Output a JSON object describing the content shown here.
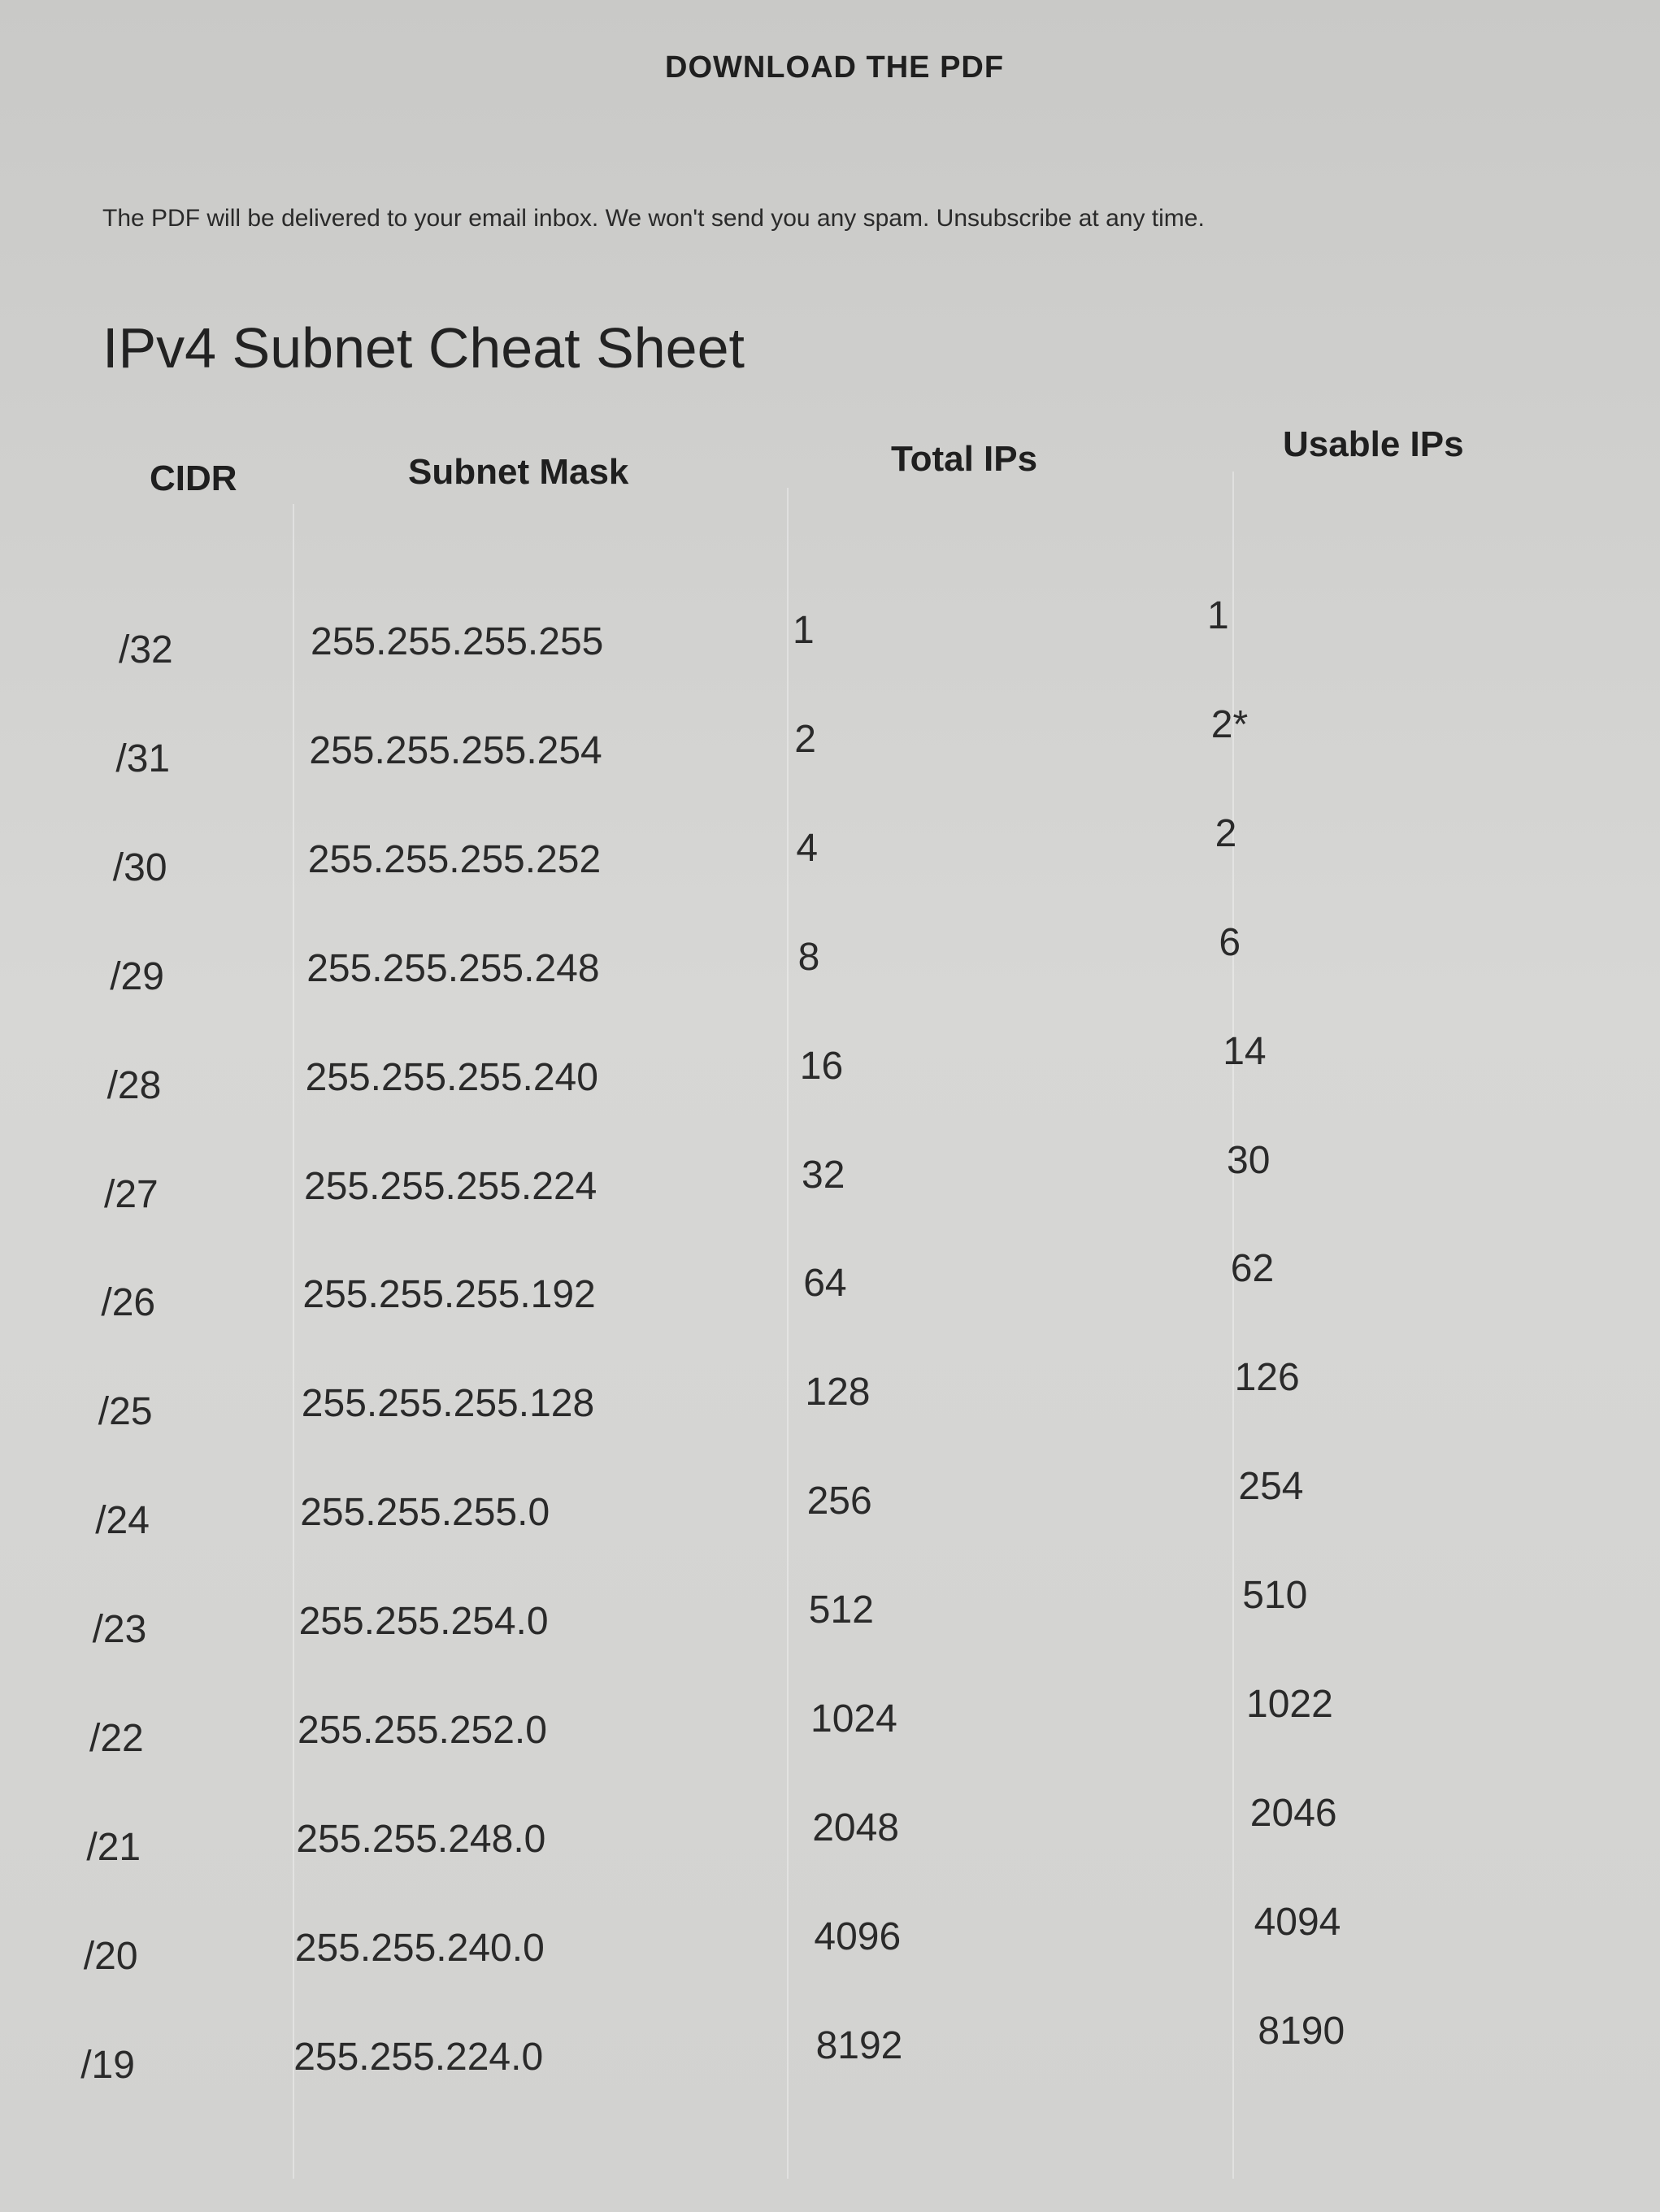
{
  "download_link": "DOWNLOAD THE PDF",
  "notice": "The PDF will be delivered to your email inbox. We won't send you any spam. Unsubscribe at any time.",
  "title": "IPv4 Subnet Cheat Sheet",
  "table": {
    "headers": {
      "cidr": "CIDR",
      "subnet_mask": "Subnet Mask",
      "total_ips": "Total IPs",
      "usable_ips": "Usable IPs"
    },
    "rows": [
      {
        "cidr": "/32",
        "mask": "255.255.255.255",
        "total": "1",
        "usable": "1"
      },
      {
        "cidr": "/31",
        "mask": "255.255.255.254",
        "total": "2",
        "usable": "2*"
      },
      {
        "cidr": "/30",
        "mask": "255.255.255.252",
        "total": "4",
        "usable": "2"
      },
      {
        "cidr": "/29",
        "mask": "255.255.255.248",
        "total": "8",
        "usable": "6"
      },
      {
        "cidr": "/28",
        "mask": "255.255.255.240",
        "total": "16",
        "usable": "14"
      },
      {
        "cidr": "/27",
        "mask": "255.255.255.224",
        "total": "32",
        "usable": "30"
      },
      {
        "cidr": "/26",
        "mask": "255.255.255.192",
        "total": "64",
        "usable": "62"
      },
      {
        "cidr": "/25",
        "mask": "255.255.255.128",
        "total": "128",
        "usable": "126"
      },
      {
        "cidr": "/24",
        "mask": "255.255.255.0",
        "total": "256",
        "usable": "254"
      },
      {
        "cidr": "/23",
        "mask": "255.255.254.0",
        "total": "512",
        "usable": "510"
      },
      {
        "cidr": "/22",
        "mask": "255.255.252.0",
        "total": "1024",
        "usable": "1022"
      },
      {
        "cidr": "/21",
        "mask": "255.255.248.0",
        "total": "2048",
        "usable": "2046"
      },
      {
        "cidr": "/20",
        "mask": "255.255.240.0",
        "total": "4096",
        "usable": "4094"
      },
      {
        "cidr": "/19",
        "mask": "255.255.224.0",
        "total": "8192",
        "usable": "8190"
      }
    ]
  }
}
